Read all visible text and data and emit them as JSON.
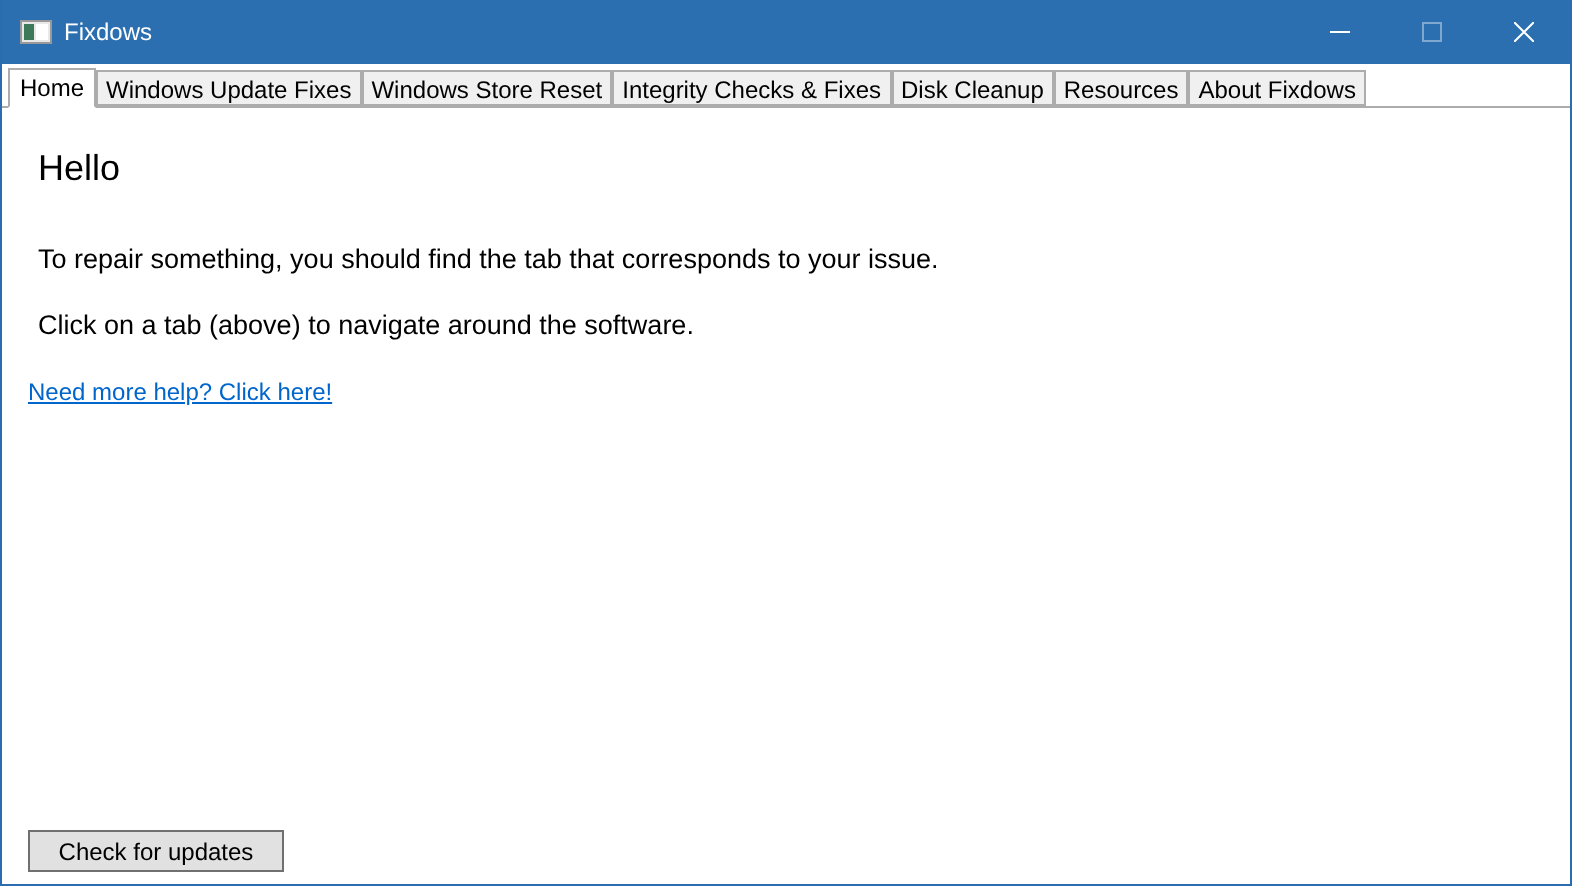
{
  "window": {
    "title": "Fixdows",
    "maximize_disabled": true
  },
  "tabs": [
    {
      "label": "Home",
      "selected": true
    },
    {
      "label": "Windows Update Fixes",
      "selected": false
    },
    {
      "label": "Windows Store Reset",
      "selected": false
    },
    {
      "label": "Integrity Checks & Fixes",
      "selected": false
    },
    {
      "label": "Disk Cleanup",
      "selected": false
    },
    {
      "label": "Resources",
      "selected": false
    },
    {
      "label": "About Fixdows",
      "selected": false
    }
  ],
  "heading": "Hello",
  "paragraphs": [
    "To repair something, you should find the tab that corresponds to your issue.",
    "Click on a tab (above) to navigate around the software."
  ],
  "help_link": "Need more help? Click here!",
  "update_button": "Check for updates"
}
